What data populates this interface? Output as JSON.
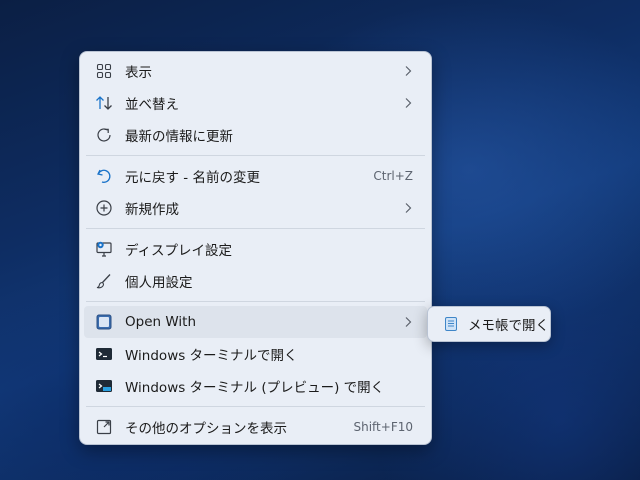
{
  "menu": {
    "groups": [
      [
        {
          "label": "表示",
          "icon": "grid-view-icon",
          "arrow": true
        },
        {
          "label": "並べ替え",
          "icon": "sort-arrows-icon",
          "arrow": true
        },
        {
          "label": "最新の情報に更新",
          "icon": "refresh-icon"
        }
      ],
      [
        {
          "label": "元に戻す - 名前の変更",
          "icon": "undo-icon",
          "shortcut": "Ctrl+Z"
        },
        {
          "label": "新規作成",
          "icon": "add-circle-icon",
          "arrow": true
        }
      ],
      [
        {
          "label": "ディスプレイ設定",
          "icon": "display-settings-icon"
        },
        {
          "label": "個人用設定",
          "icon": "brush-icon"
        }
      ],
      [
        {
          "label": "Open With",
          "icon": "app-window-icon",
          "arrow": true,
          "highlighted": true
        },
        {
          "label": "Windows ターミナルで開く",
          "icon": "terminal-icon"
        },
        {
          "label": "Windows ターミナル (プレビュー) で開く",
          "icon": "terminal-preview-icon"
        }
      ],
      [
        {
          "label": "その他のオプションを表示",
          "icon": "more-options-icon",
          "shortcut": "Shift+F10"
        }
      ]
    ]
  },
  "submenu": {
    "items": [
      {
        "label": "メモ帳で開く",
        "icon": "notepad-icon"
      }
    ]
  },
  "colors": {
    "menu_background": "#e9eef6",
    "highlight": "#dde3ec",
    "accent": "#1a73c9"
  }
}
